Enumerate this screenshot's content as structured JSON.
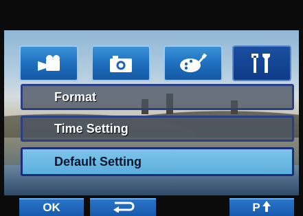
{
  "tabs": [
    {
      "icon": "video-camera-icon",
      "active": false
    },
    {
      "icon": "camera-icon",
      "active": false
    },
    {
      "icon": "palette-brush-icon",
      "active": false
    },
    {
      "icon": "tools-icon",
      "active": true
    }
  ],
  "menu": {
    "items": [
      {
        "label": "Format",
        "selected": false
      },
      {
        "label": "Time Setting",
        "selected": false
      },
      {
        "label": "Default Setting",
        "selected": true
      }
    ]
  },
  "bottom": {
    "ok_label": "OK",
    "return_icon": "return-arrow-icon",
    "page_label": "P",
    "page_icon": "up-arrow-icon"
  },
  "colors": {
    "tab_blue": "#1f6fbe",
    "tab_active": "#0e3b86",
    "selected_item": "#6bb8e3",
    "item_border": "#2b3f86"
  }
}
